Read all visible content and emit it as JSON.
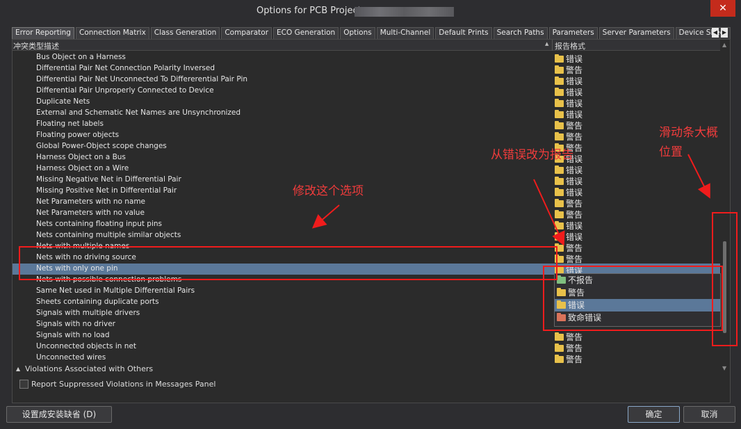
{
  "window": {
    "title": "Options for PCB Project",
    "close_glyph": "✕"
  },
  "tabs": [
    "Error Reporting",
    "Connection Matrix",
    "Class Generation",
    "Comparator",
    "ECO Generation",
    "Options",
    "Multi-Channel",
    "Default Prints",
    "Search Paths",
    "Parameters",
    "Server Parameters",
    "Device Sheet"
  ],
  "tab_scroll": {
    "left": "◀",
    "right": "▶"
  },
  "columns": {
    "type": "冲突类型描述",
    "level": "报告格式"
  },
  "rows": [
    {
      "label": "Bus Object on a Harness",
      "level": "错误"
    },
    {
      "label": "Differential Pair Net Connection Polarity Inversed",
      "level": "警告"
    },
    {
      "label": "Differential Pair Net Unconnected To Differerential Pair Pin",
      "level": "错误"
    },
    {
      "label": "Differential Pair Unproperly Connected to Device",
      "level": "错误"
    },
    {
      "label": "Duplicate Nets",
      "level": "错误"
    },
    {
      "label": "External and Schematic Net Names are Unsynchronized",
      "level": "错误"
    },
    {
      "label": "Floating net labels",
      "level": "警告"
    },
    {
      "label": "Floating power objects",
      "level": "警告"
    },
    {
      "label": "Global Power-Object scope changes",
      "level": "警告"
    },
    {
      "label": "Harness Object on a Bus",
      "level": "错误"
    },
    {
      "label": "Harness Object on a Wire",
      "level": "错误"
    },
    {
      "label": "Missing Negative Net in Differential Pair",
      "level": "错误"
    },
    {
      "label": "Missing Positive Net in Differential Pair",
      "level": "错误"
    },
    {
      "label": "Net Parameters with no name",
      "level": "警告"
    },
    {
      "label": "Net Parameters with no value",
      "level": "警告"
    },
    {
      "label": "Nets containing floating input pins",
      "level": "错误"
    },
    {
      "label": "Nets containing multiple similar objects",
      "level": "错误"
    },
    {
      "label": "Nets with multiple names",
      "level": "警告"
    },
    {
      "label": "Nets with no driving source",
      "level": "警告"
    },
    {
      "label": "Nets with only one pin",
      "level": "错误"
    },
    {
      "label": "Nets with possible connection problems",
      "level": ""
    },
    {
      "label": "Same Net used in Multiple Differential Pairs",
      "level": ""
    },
    {
      "label": "Sheets containing duplicate ports",
      "level": ""
    },
    {
      "label": "Signals with multiple drivers",
      "level": ""
    },
    {
      "label": "Signals with no driver",
      "level": ""
    },
    {
      "label": "Signals with no load",
      "level": "警告"
    },
    {
      "label": "Unconnected objects in net",
      "level": "警告"
    },
    {
      "label": "Unconnected wires",
      "level": "警告"
    }
  ],
  "group": {
    "label": "Violations Associated with Others",
    "arrow": "▲"
  },
  "dropdown": {
    "options": [
      {
        "label": "不报告",
        "color": "green"
      },
      {
        "label": "警告",
        "color": "yellow"
      },
      {
        "label": "错误",
        "color": "yellow",
        "selected": true
      },
      {
        "label": "致命错误",
        "color": "red"
      }
    ]
  },
  "checkbox": {
    "label": "Report Suppressed Violations in Messages Panel"
  },
  "buttons": {
    "reset": "设置成安装缺省 (D)",
    "ok": "确定",
    "cancel": "取消"
  },
  "scroll_glyphs": {
    "up": "▲",
    "down": "▼",
    "sort": "▲"
  },
  "annotations": {
    "modify_option": "修改这个选项",
    "error_to_report": "从错误改为报告",
    "scrollbar_position_1": "滑动条大概",
    "scrollbar_position_2": "位置"
  },
  "colors": {
    "selection": "#5b7899",
    "annotation": "#f01c1c",
    "folder": "#e8c14a"
  }
}
